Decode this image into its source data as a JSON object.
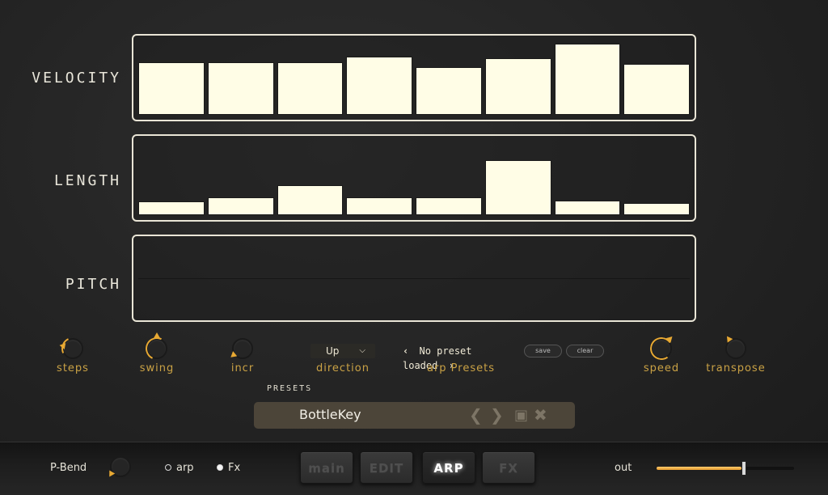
{
  "lanes": {
    "velocity": {
      "label": "VELOCITY",
      "values": [
        0.71,
        0.71,
        0.71,
        0.78,
        0.64,
        0.76,
        0.96,
        0.68
      ]
    },
    "length": {
      "label": "LENGTH",
      "values": [
        0.18,
        0.24,
        0.4,
        0.24,
        0.24,
        0.74,
        0.2,
        0.16
      ]
    },
    "pitch": {
      "label": "PITCH",
      "values": []
    }
  },
  "controls": {
    "steps": "steps",
    "swing": "swing",
    "incr": "incr",
    "direction_label": "direction",
    "direction_value": "Up",
    "arp_presets_label": "arp Presets",
    "arp_preset_value": "No preset loaded",
    "prev_glyph": "‹",
    "next_glyph": "›",
    "save_label": "save",
    "clear_label": "clear",
    "speed": "speed",
    "transpose": "transpose"
  },
  "presets": {
    "title": "PRESETS",
    "current": "BottleKey"
  },
  "bottom": {
    "pbend_label": "P-Bend",
    "radio_arp": "arp",
    "radio_fx": "Fx",
    "selected_mode": "Fx",
    "tabs": [
      "main",
      "EDIT",
      "ARP",
      "FX"
    ],
    "active_tab": "ARP",
    "out_label": "out",
    "out_level": 0.62
  },
  "colors": {
    "accent": "#e8a933",
    "bar": "#fffde6",
    "label_gold": "#caa245"
  },
  "icons": {
    "save": "floppy-icon",
    "delete": "close-icon",
    "prev": "chevron-left-icon",
    "next": "chevron-right-icon"
  }
}
